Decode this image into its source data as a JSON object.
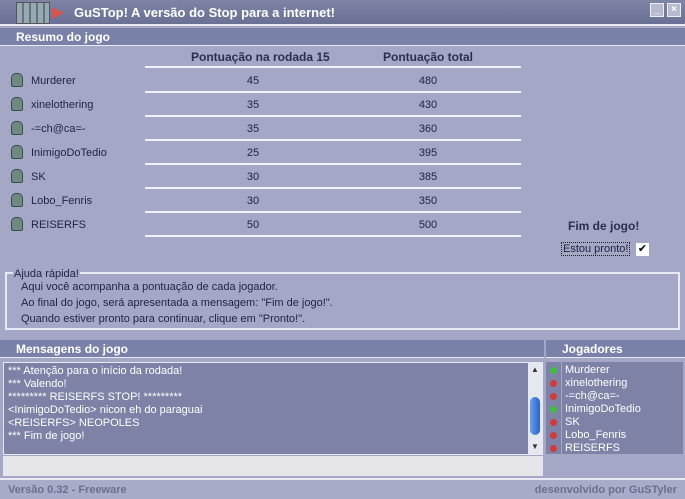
{
  "window": {
    "title": "GuSTop!  A versão do Stop para a internet!",
    "minimize": "_",
    "close": "×"
  },
  "summary": {
    "header": "Resumo do jogo",
    "col_round": "Pontuação na rodada 15",
    "col_total": "Pontuação total",
    "rows": [
      {
        "name": "Murderer",
        "round": "45",
        "total": "480"
      },
      {
        "name": "xinelothering",
        "round": "35",
        "total": "430"
      },
      {
        "name": "-=ch@ca=-",
        "round": "35",
        "total": "360"
      },
      {
        "name": "InimigoDoTedio",
        "round": "25",
        "total": "395"
      },
      {
        "name": "SK",
        "round": "30",
        "total": "385"
      },
      {
        "name": "Lobo_Fenris",
        "round": "30",
        "total": "350"
      },
      {
        "name": "REISERFS",
        "round": "50",
        "total": "500"
      }
    ],
    "end_label": "Fim de jogo!",
    "ready_label": "Estou pronto!",
    "ready_checked": true
  },
  "help": {
    "legend": "Ajuda rápida!",
    "lines": [
      "Aqui você acompanha a pontuação de cada jogador.",
      "Ao final do jogo, será apresentada a mensagem: \"Fim de jogo!\".",
      "Quando estiver pronto para continuar, clique em \"Pronto!\"."
    ]
  },
  "messages": {
    "header": "Mensagens do jogo",
    "lines": [
      "*** Atenção para o início da rodada!",
      "*** Valendo!",
      "********* REISERFS STOP! *********",
      "<InimigoDoTedio> nicon eh do paraguai",
      "<REISERFS> NEOPOLES",
      "*** Fim de jogo!"
    ]
  },
  "players": {
    "header": "Jogadores",
    "list": [
      {
        "name": "Murderer",
        "status": "ready"
      },
      {
        "name": "xinelothering",
        "status": "not-ready"
      },
      {
        "name": "-=ch@ca=-",
        "status": "not-ready"
      },
      {
        "name": "InimigoDoTedio",
        "status": "ready"
      },
      {
        "name": "SK",
        "status": "not-ready"
      },
      {
        "name": "Lobo_Fenris",
        "status": "not-ready"
      },
      {
        "name": "REISERFS",
        "status": "not-ready"
      }
    ]
  },
  "colors": {
    "ready": "#3fbf3f",
    "not-ready": "#d23a3a"
  },
  "footer": {
    "version": "Versão 0.32 - Freeware",
    "credit": "desenvolvido por GuSTyler"
  }
}
